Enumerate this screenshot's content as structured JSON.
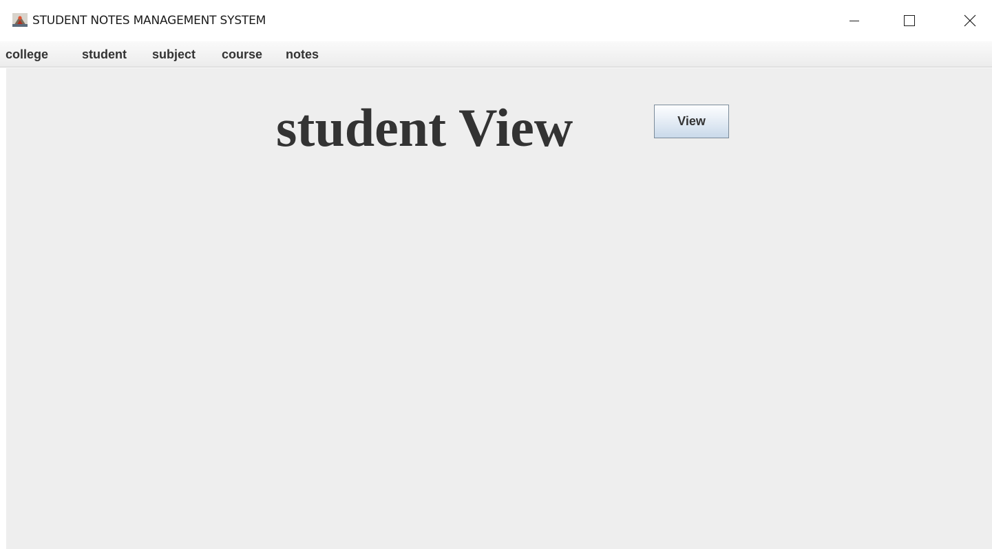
{
  "window": {
    "title": "STUDENT NOTES MANAGEMENT SYSTEM",
    "controls": [
      "minimize-icon",
      "maximize-icon",
      "close-icon"
    ]
  },
  "menubar": {
    "items": [
      {
        "label": "college"
      },
      {
        "label": "student"
      },
      {
        "label": "subject"
      },
      {
        "label": "course"
      },
      {
        "label": "notes"
      }
    ]
  },
  "main": {
    "heading": "student View",
    "view_button_label": "View"
  },
  "colors": {
    "content_background": "#eeeeee",
    "text": "#333333"
  }
}
